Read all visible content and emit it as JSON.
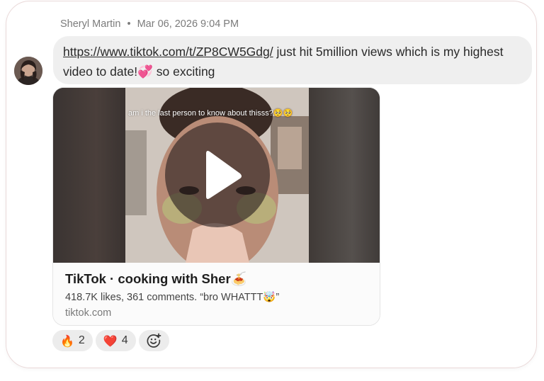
{
  "message": {
    "author": "Sheryl Martin",
    "separator": "•",
    "timestamp": "Mar 06, 2026 9:04 PM",
    "link": "https://www.tiktok.com/t/ZP8CW5Gdg/",
    "text_part1": " just hit 5million views which is my highest video to date!",
    "emoji1": "💞",
    "text_part2": " so exciting"
  },
  "embed": {
    "overlay_caption": "am i the last person to know about thisss?🥺🥺",
    "title": "TikTok · cooking with Sher🍝",
    "description": "418.7K likes, 361 comments. “bro WHATTT🤯”",
    "domain": "tiktok.com"
  },
  "reactions": [
    {
      "emoji": "🔥",
      "count": "2"
    },
    {
      "emoji": "❤️",
      "count": "4"
    }
  ],
  "icons": {
    "add_reaction": "smiley-plus-icon",
    "play": "play-icon"
  },
  "colors": {
    "bubble_bg": "#efefef",
    "card_border": "#ead9d9",
    "reaction_bg": "#ececec"
  }
}
